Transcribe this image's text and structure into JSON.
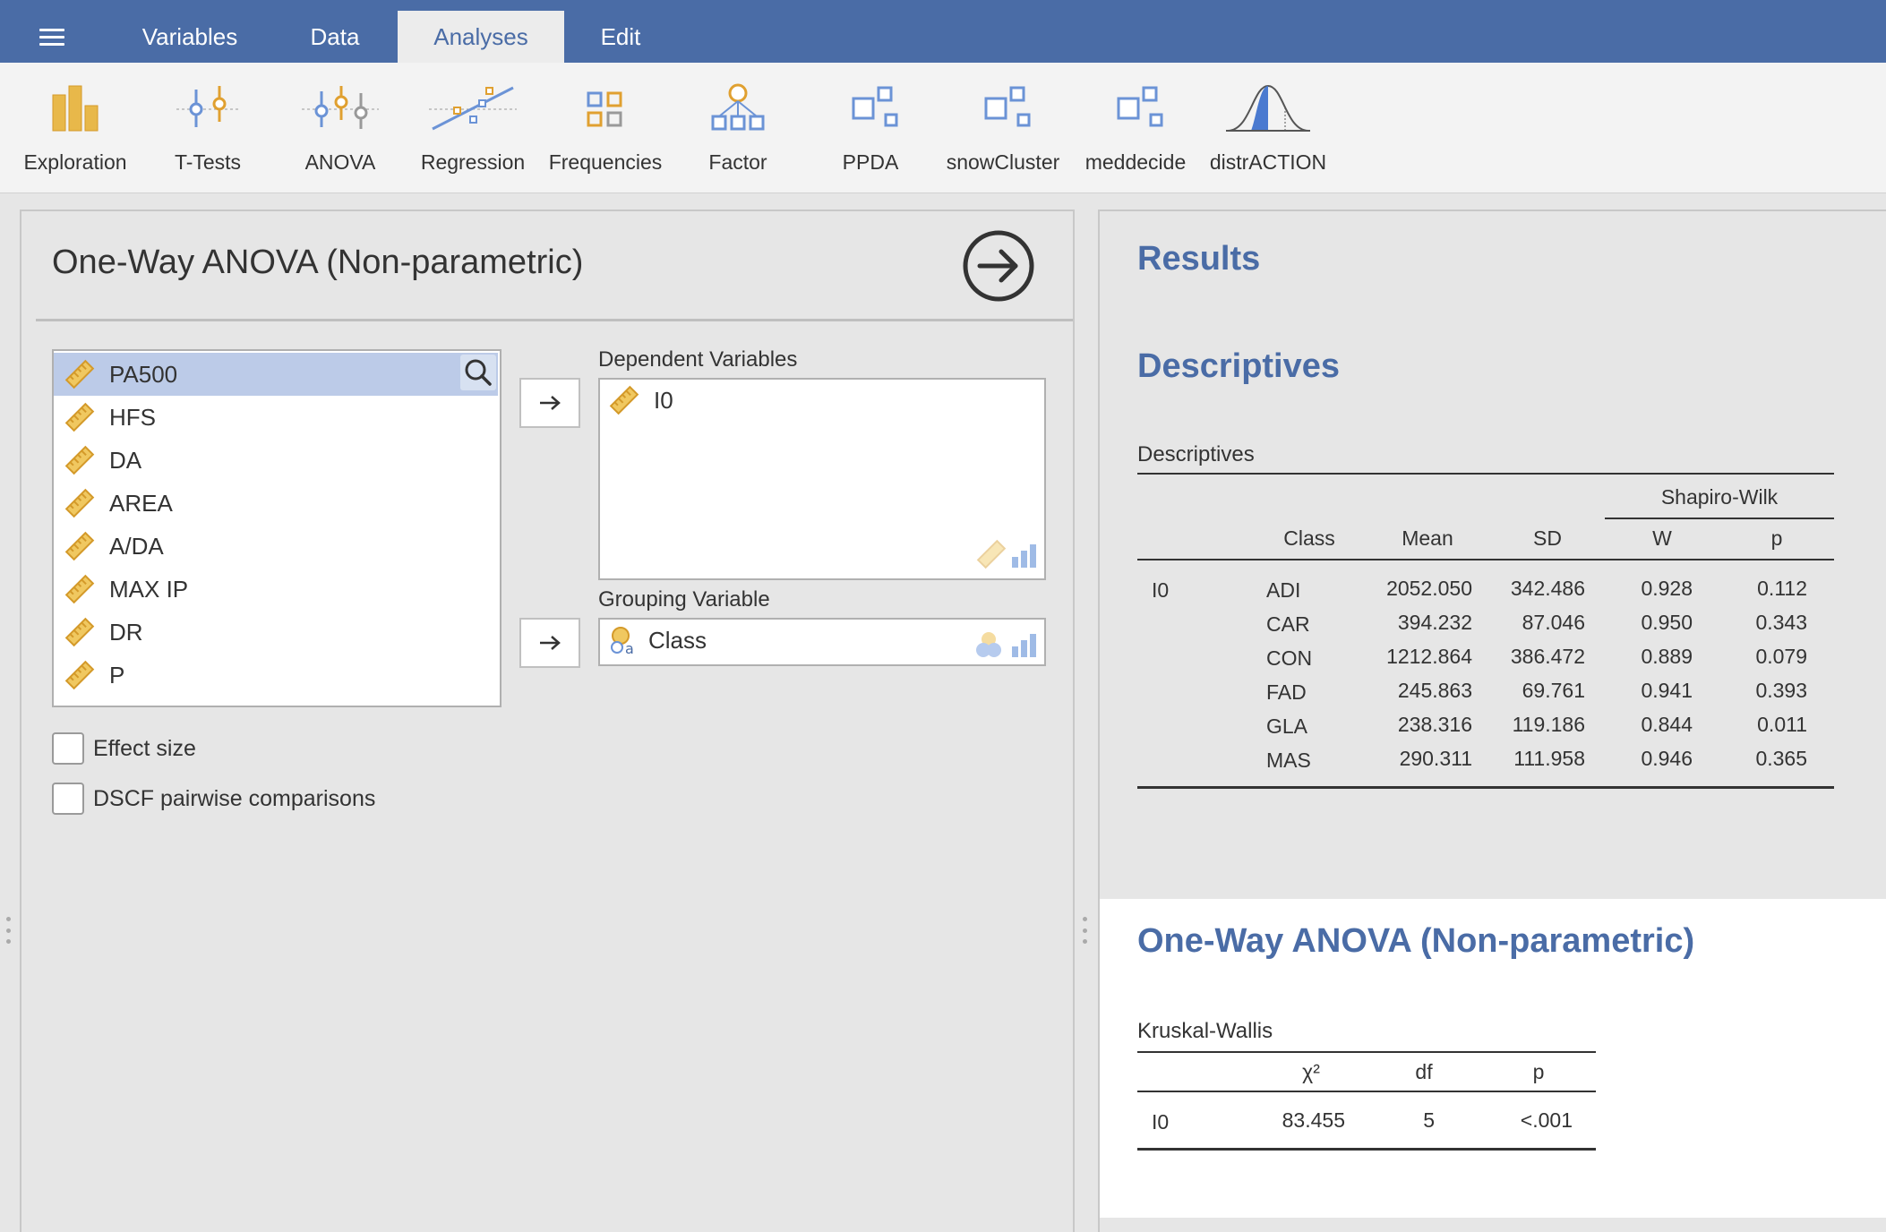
{
  "topbar": {
    "menu_icon": "hamburger-icon",
    "tabs": [
      {
        "label": "Variables",
        "active": false
      },
      {
        "label": "Data",
        "active": false
      },
      {
        "label": "Analyses",
        "active": true
      },
      {
        "label": "Edit",
        "active": false
      }
    ]
  },
  "ribbon": {
    "buttons": [
      {
        "label": "Exploration",
        "icon": "exploration-icon"
      },
      {
        "label": "T-Tests",
        "icon": "ttests-icon"
      },
      {
        "label": "ANOVA",
        "icon": "anova-icon"
      },
      {
        "label": "Regression",
        "icon": "regression-icon"
      },
      {
        "label": "Frequencies",
        "icon": "frequencies-icon"
      },
      {
        "label": "Factor",
        "icon": "factor-icon"
      },
      {
        "label": "PPDA",
        "icon": "module-icon"
      },
      {
        "label": "snowCluster",
        "icon": "module-icon"
      },
      {
        "label": "meddecide",
        "icon": "module-icon"
      },
      {
        "label": "distrACTION",
        "icon": "distribution-icon"
      }
    ]
  },
  "options": {
    "title": "One-Way ANOVA (Non-parametric)",
    "variables": [
      "PA500",
      "HFS",
      "DA",
      "AREA",
      "A/DA",
      "MAX IP",
      "DR",
      "P"
    ],
    "selected_variable": "PA500",
    "dependent_label": "Dependent Variables",
    "dependent_vars": [
      "I0"
    ],
    "grouping_label": "Grouping Variable",
    "grouping_var": "Class",
    "checkboxes": [
      {
        "label": "Effect size",
        "checked": false
      },
      {
        "label": "DSCF pairwise comparisons",
        "checked": false
      }
    ]
  },
  "results": {
    "heading": "Results",
    "descriptives_heading": "Descriptives",
    "descriptives_table": {
      "title": "Descriptives",
      "group_header": "Shapiro-Wilk",
      "columns": [
        "Class",
        "Mean",
        "SD",
        "W",
        "p"
      ],
      "variable": "I0",
      "rows": [
        {
          "class": "ADI",
          "mean": "2052.050",
          "sd": "342.486",
          "w": "0.928",
          "p": "0.112"
        },
        {
          "class": "CAR",
          "mean": "394.232",
          "sd": "87.046",
          "w": "0.950",
          "p": "0.343"
        },
        {
          "class": "CON",
          "mean": "1212.864",
          "sd": "386.472",
          "w": "0.889",
          "p": "0.079"
        },
        {
          "class": "FAD",
          "mean": "245.863",
          "sd": "69.761",
          "w": "0.941",
          "p": "0.393"
        },
        {
          "class": "GLA",
          "mean": "238.316",
          "sd": "119.186",
          "w": "0.844",
          "p": "0.011"
        },
        {
          "class": "MAS",
          "mean": "290.311",
          "sd": "111.958",
          "w": "0.946",
          "p": "0.365"
        }
      ]
    },
    "anova_heading": "One-Way ANOVA (Non-parametric)",
    "kw_table": {
      "title": "Kruskal-Wallis",
      "columns": [
        "χ²",
        "df",
        "p"
      ],
      "row": {
        "variable": "I0",
        "chi2": "83.455",
        "df": "5",
        "p": "<.001"
      }
    }
  },
  "colors": {
    "brand": "#4a6ca6",
    "selection": "#bccbe8",
    "ruler": "#e8b84a"
  }
}
